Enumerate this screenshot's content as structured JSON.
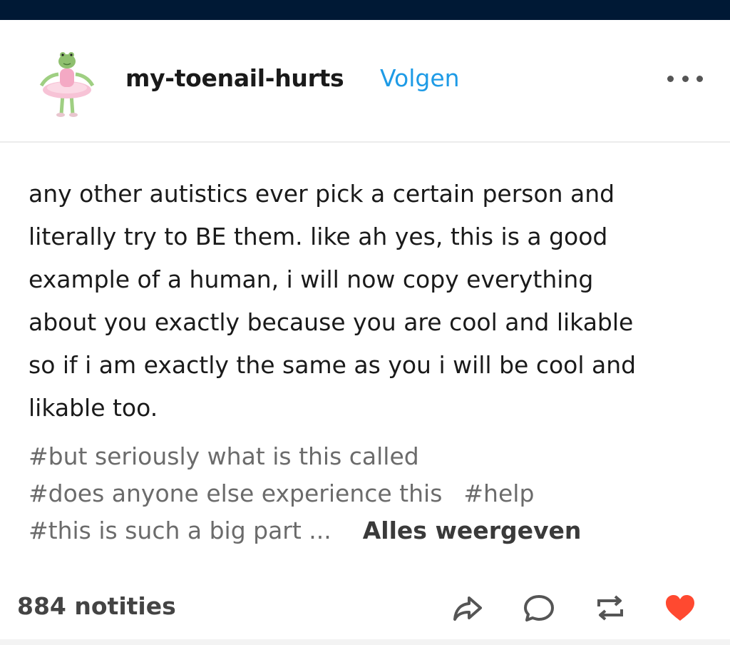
{
  "post": {
    "author": "my-toenail-hurts",
    "follow_label": "Volgen",
    "body_lines": [
      "any other autistics ever pick a certain person and",
      "literally try to BE them. like ah yes, this is a good",
      "example of a human, i will now copy everything",
      "about you exactly because you are cool and likable",
      "so if i am exactly the same as you i will be cool and",
      "likable too."
    ],
    "tags": {
      "line1": [
        "#but seriously what is this called"
      ],
      "line2": [
        "#does anyone else experience this",
        "#help"
      ],
      "line3": [
        "#this is such a big part ..."
      ]
    },
    "show_all_label": "Alles weergeven",
    "notes_label": "884 notities"
  },
  "icons": {
    "avatar": "frog-ballerina-avatar",
    "more": "more-options-icon",
    "share": "share-icon",
    "reply": "reply-icon",
    "reblog": "reblog-icon",
    "like": "heart-icon"
  },
  "colors": {
    "top_bar": "#001935",
    "follow": "#1e9be6",
    "tag_text": "#6b6b6b",
    "heart": "#ff4930"
  }
}
